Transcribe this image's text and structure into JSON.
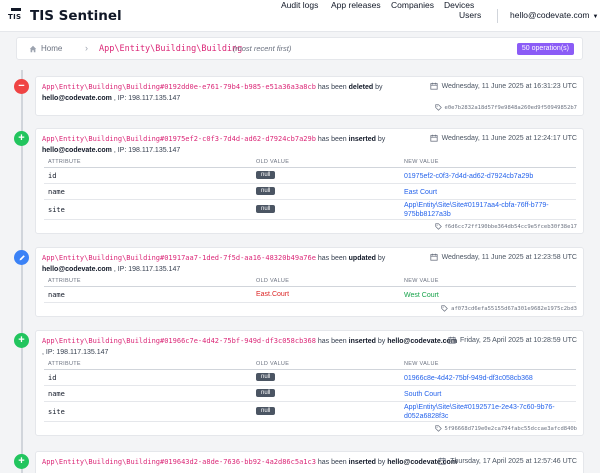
{
  "app": {
    "logo_text": "TIS",
    "name": "TIS Sentinel"
  },
  "nav": {
    "items": [
      "Audit logs",
      "App releases",
      "Companies",
      "Devices",
      "Users"
    ],
    "user": "hello@codevate.com"
  },
  "breadcrumb": {
    "home": "Home",
    "entity": "App\\Entity\\Building\\Building",
    "note": "(most recent first)",
    "badge": "50 operation(s)"
  },
  "diff_headers": {
    "attribute": "ATTRIBUTE",
    "old_value": "OLD VALUE",
    "new_value": "NEW VALUE"
  },
  "entries": [
    {
      "type": "deleted",
      "entity": "App\\Entity\\Building\\Building#0192dd0e-e761-79b4-b985-e51a36a3a8cb",
      "verb_prefix": "has been",
      "verb": "deleted",
      "by_label": "by",
      "user": "hello@codevate.com",
      "ip": ", IP: 198.117.135.147",
      "date": "Wednesday, 11 June 2025 at 16:31:23 UTC",
      "hash": "e0e7b2832a18d57f9e9848a260ed9f50949852b7"
    },
    {
      "type": "inserted",
      "entity": "App\\Entity\\Building\\Building#01975ef2-c0f3-7d4d-ad62-d7924cb7a29b",
      "verb_prefix": "has been",
      "verb": "inserted",
      "by_label": "by",
      "user": "hello@codevate.com",
      "ip": ", IP: 198.117.135.147",
      "date": "Wednesday, 11 June 2025 at 12:24:17 UTC",
      "hash": "f6d6cc72ff190bbe364db54cc9e5fceb30f38e17",
      "rows": [
        {
          "attr": "id",
          "old": "null",
          "new": "01975ef2-c0f3-7d4d-ad62-d7924cb7a29b"
        },
        {
          "attr": "name",
          "old": "null",
          "new": "East Court"
        },
        {
          "attr": "site",
          "old": "null",
          "new": "App\\Entity\\Site\\Site#01917aa4-cbfa-76ff-b779-975bb8127a3b"
        }
      ]
    },
    {
      "type": "updated",
      "entity": "App\\Entity\\Building\\Building#01917aa7-1ded-7f5d-aa16-48320b49a76e",
      "verb_prefix": "has been",
      "verb": "updated",
      "by_label": "by",
      "user": "hello@codevate.com",
      "ip": ", IP: 198.117.135.147",
      "date": "Wednesday, 11 June 2025 at 12:23:58 UTC",
      "hash": "af073cd6efa55155d67a301e9682e1975c2bd3",
      "rows": [
        {
          "attr": "name",
          "old": "East.Court",
          "new": "West Court"
        }
      ]
    },
    {
      "type": "inserted",
      "entity": "App\\Entity\\Building\\Building#01966c7e-4d42-75bf-949d-df3c058cb368",
      "verb_prefix": "has been",
      "verb": "inserted",
      "by_label": "by",
      "user": "hello@codevate.com",
      "ip": ", IP: 198.117.135.147",
      "date": "Friday, 25 April 2025 at 10:28:59 UTC",
      "hash": "5f96668d719e0e2ca794fabc55dccae3afcd840b",
      "rows": [
        {
          "attr": "id",
          "old": "null",
          "new": "01966c8e-4d42-75bf-949d-df3c058cb368"
        },
        {
          "attr": "name",
          "old": "null",
          "new": "South Court"
        },
        {
          "attr": "site",
          "old": "null",
          "new": "App\\Entity\\Site\\Site#0192571e-2e43-7c60-9b76-d052a6828f3c"
        }
      ]
    },
    {
      "type": "inserted",
      "entity": "App\\Entity\\Building\\Building#019643d2-a8de-7636-bb92-4a2d86c5a1c3",
      "verb_prefix": "has been",
      "verb": "inserted",
      "by_label": "by",
      "user": "hello@codevate.com",
      "ip": "",
      "date": "Thursday, 17 April 2025 at 12:57:46 UTC",
      "hash": ""
    }
  ]
}
